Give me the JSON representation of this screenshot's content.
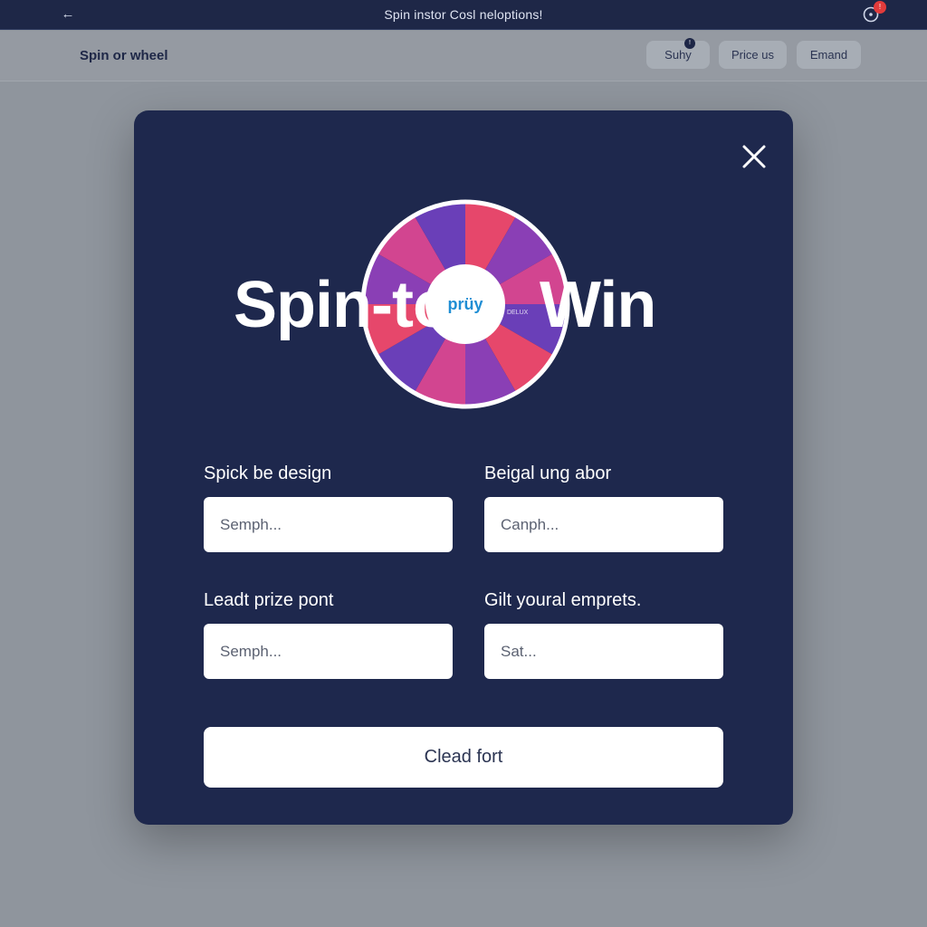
{
  "topbar": {
    "back_icon": "arrow-left-icon",
    "title": "Spin instor Cosl neloptions!",
    "notification_icon": "bell-icon",
    "notification_badge": "!"
  },
  "subheader": {
    "brand": "Spin or wheel",
    "buttons": [
      {
        "label": "Suhy",
        "badge": "!"
      },
      {
        "label": "Price us"
      },
      {
        "label": "Emand"
      }
    ]
  },
  "modal": {
    "close_icon": "close-icon",
    "hero": {
      "left_text": "Spin-to",
      "right_text": "Win",
      "hub_text": "prüy",
      "hub_subtext": "DELUX",
      "wheel_colors": [
        "#e6476b",
        "#8a3fb5",
        "#d24590",
        "#6a3fb8"
      ]
    },
    "fields": [
      {
        "label": "Spick be design",
        "placeholder": "Semph..."
      },
      {
        "label": "Beigal ung abor",
        "placeholder": "Canph..."
      },
      {
        "label": "Leadt prize pont",
        "placeholder": "Semph..."
      },
      {
        "label": "Gilt youral emprets.",
        "placeholder": "Sat..."
      }
    ],
    "submit_label": "Clead fort"
  },
  "colors": {
    "topbar_bg": "#1e2747",
    "modal_bg": "#1e284d",
    "page_bg": "#8f959d",
    "accent_badge": "#e23b3b"
  }
}
